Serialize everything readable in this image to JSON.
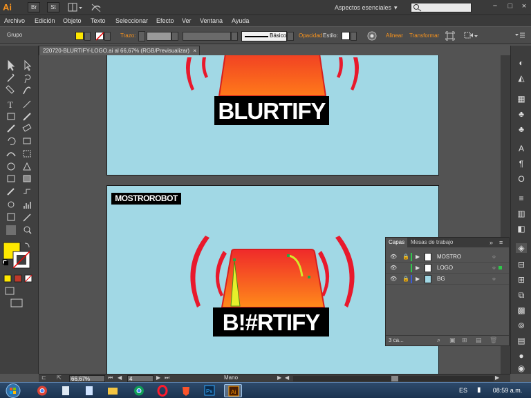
{
  "app": {
    "logo": "Ai",
    "bridge_button": "Br",
    "stock_button": "St",
    "arrange_icon": "arrange-documents-icon",
    "workspace_label": "Aspectos esenciales",
    "search": {
      "value": "",
      "icon": "search-icon"
    },
    "window_buttons": [
      "−",
      "□",
      "×"
    ]
  },
  "menu": [
    "Archivo",
    "Edición",
    "Objeto",
    "Texto",
    "Seleccionar",
    "Efecto",
    "Ver",
    "Ventana",
    "Ayuda"
  ],
  "control": {
    "selection_type": "Grupo",
    "fill_color": "#ffe800",
    "stroke_label": "Trazo:",
    "stroke_style": "Básico",
    "opacity_label": "Opacidad",
    "style_label": "Estilo:",
    "align_label": "Alinear",
    "transform_label": "Transformar"
  },
  "document": {
    "tab_title": "220720-BLURTIFY-LOGO.ai al 66,67% (RGB/Previsualizar)",
    "close_icon": "×"
  },
  "artwork": {
    "top_logo_text": "BLURTIFY",
    "bottom_logo_text": "B!#RTIFY",
    "badge_text": "MOSTROROBOT",
    "colors": {
      "artboard": "#a1d8e5",
      "siren_top": "#ef3a24",
      "siren_bottom": "#ff7a1a",
      "waves": "#e8192c",
      "bar": "#000000",
      "highlight": "#e6f02a"
    }
  },
  "layers": {
    "tabs": [
      "Capas",
      "Mesas de trabajo"
    ],
    "rows": [
      {
        "name": "MOSTRO",
        "color": "#2ec84a"
      },
      {
        "name": "LOGO",
        "color": "#2ec84a"
      },
      {
        "name": "BG",
        "color": "#3b5bd6"
      }
    ],
    "count": "3 ca..."
  },
  "status": {
    "zoom": "66,67%",
    "artboard_nav": "4",
    "tool": "Mano"
  },
  "taskbar": {
    "language": "ES",
    "time": "08:59 a.m."
  }
}
